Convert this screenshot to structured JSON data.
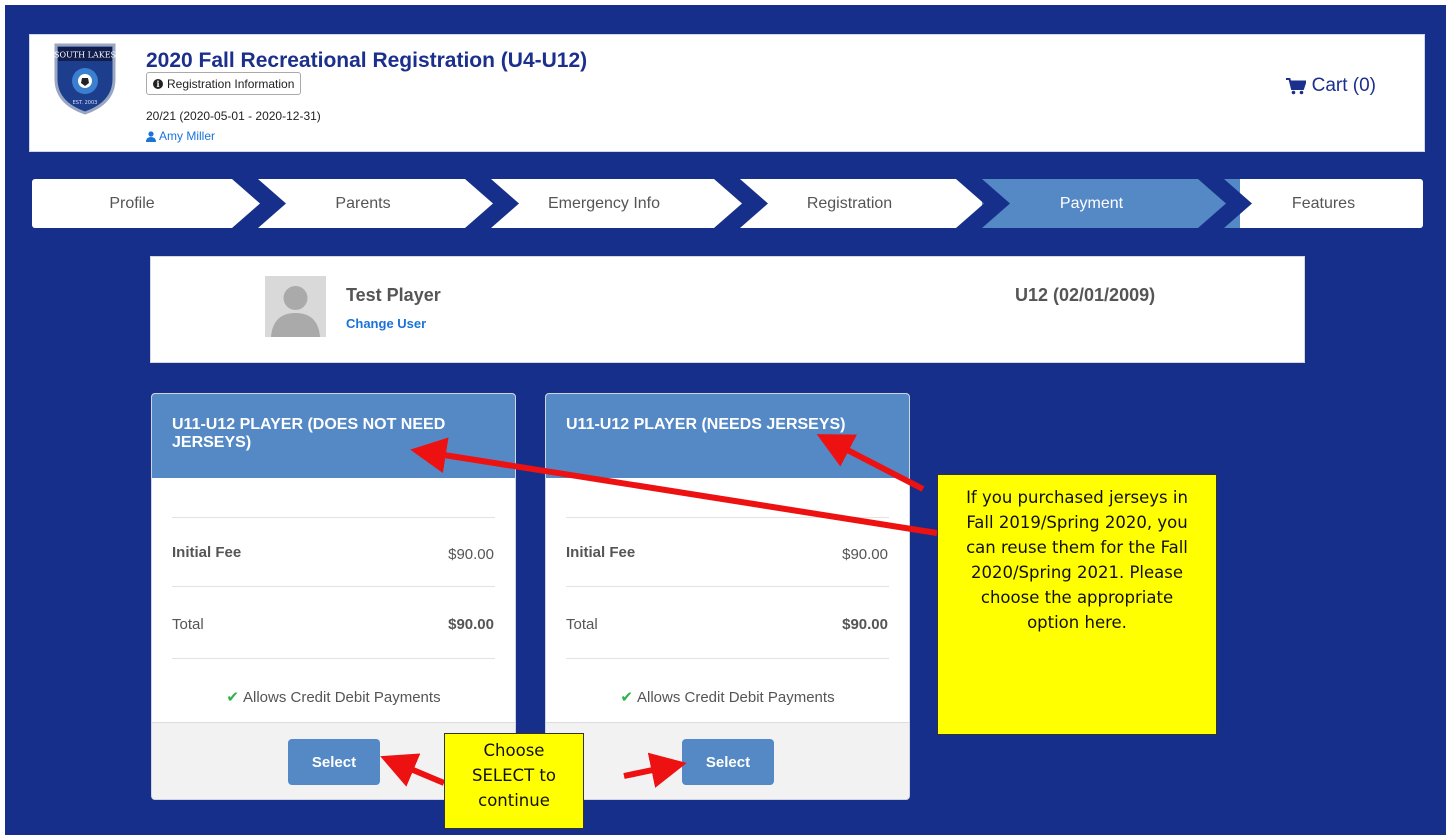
{
  "header": {
    "title": "2020 Fall Recreational Registration (U4-U12)",
    "reg_info_label": "Registration Information",
    "season": "20/21 (2020-05-01 - 2020-12-31)",
    "user_name": "Amy Miller",
    "cart_label": "Cart (0)",
    "logo_text": "SOUTH LAKES",
    "logo_sub": "EST. 2003"
  },
  "steps": {
    "items": [
      "Profile",
      "Parents",
      "Emergency Info",
      "Registration",
      "Payment",
      "Features"
    ],
    "active": "Payment"
  },
  "player": {
    "name": "Test Player",
    "change_user_label": "Change User",
    "age_group": "U12 (02/01/2009)"
  },
  "options": [
    {
      "title": "U11-U12 PLAYER (DOES NOT NEED JERSEYS)",
      "initial_fee_label": "Initial Fee",
      "initial_fee": "$90.00",
      "total_label": "Total",
      "total": "$90.00",
      "allows": "Allows Credit Debit Payments",
      "select_label": "Select"
    },
    {
      "title": "U11-U12 PLAYER (NEEDS JERSEYS)",
      "initial_fee_label": "Initial Fee",
      "initial_fee": "$90.00",
      "total_label": "Total",
      "total": "$90.00",
      "allows": "Allows Credit Debit Payments",
      "select_label": "Select"
    }
  ],
  "callouts": {
    "jersey_note": "If you purchased jerseys in Fall 2019/Spring 2020, you can reuse them for the Fall 2020/Spring 2021. Please choose the appropriate option here.",
    "select_note": "Choose SELECT to continue"
  },
  "colors": {
    "page_bg": "#162f8a",
    "accent": "#5589c6",
    "title": "#1b2f8d",
    "link": "#1a73d9",
    "callout_bg": "#ffff00",
    "arrow": "#ee1111",
    "check": "#2db34a"
  }
}
